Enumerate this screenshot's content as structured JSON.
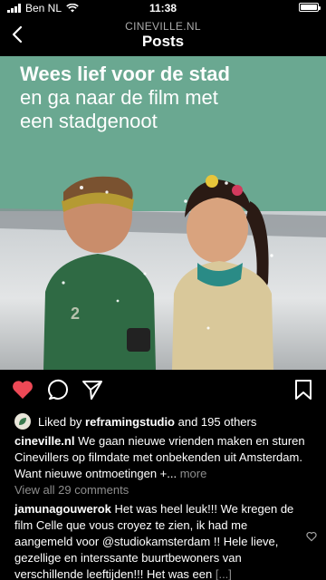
{
  "status_bar": {
    "carrier": "Ben NL",
    "time": "11:38",
    "battery_level": 1.0
  },
  "header": {
    "account": "CINEVILLE.NL",
    "title": "Posts"
  },
  "post_image": {
    "headline_line1": "Wees lief voor de stad",
    "headline_line2": "en ga naar de film met",
    "headline_line3": "een stadgenoot",
    "background_color": "#6aa891"
  },
  "actions": {
    "like_color": "#ed4956",
    "liked": true
  },
  "likes": {
    "prefix": "Liked by ",
    "user": "reframingstudio",
    "suffix": " and 195 others"
  },
  "caption": {
    "username": "cineville.nl",
    "text": " We gaan nieuwe vrienden maken en sturen Cinevillers op filmdate met onbekenden uit Amsterdam. Want nieuwe ontmoetingen +...",
    "more": " more"
  },
  "view_comments": "View all 29 comments",
  "comment": {
    "username": "jamunagouwerok",
    "text": " Het was heel leuk!!! We kregen de film Celle que vous croyez te zien, ik had me aangemeld voor @studiokamsterdam !! Hele lieve, gezellige en interssante buurtbewoners van verschillende leeftijden!!! Het was een",
    "more": " [...]"
  }
}
